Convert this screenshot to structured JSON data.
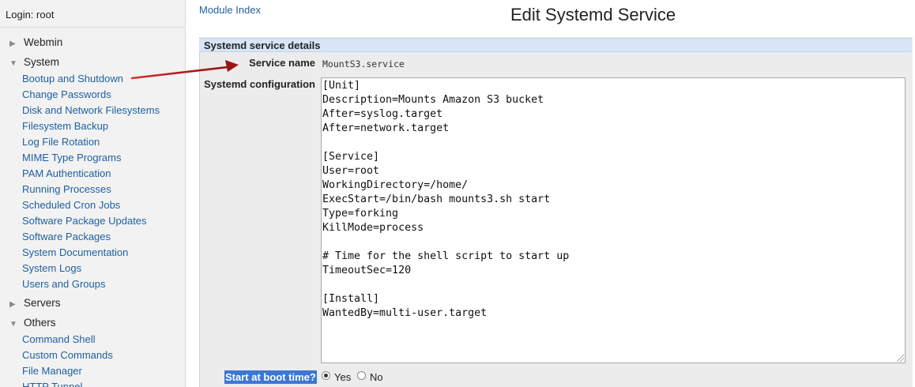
{
  "sidebar": {
    "login": "Login: root",
    "categories": [
      {
        "label": "Webmin",
        "state": "collapsed"
      },
      {
        "label": "System",
        "state": "expanded"
      },
      {
        "label": "Servers",
        "state": "collapsed"
      },
      {
        "label": "Others",
        "state": "expanded"
      }
    ],
    "system_modules": [
      "Bootup and Shutdown",
      "Change Passwords",
      "Disk and Network Filesystems",
      "Filesystem Backup",
      "Log File Rotation",
      "MIME Type Programs",
      "PAM Authentication",
      "Running Processes",
      "Scheduled Cron Jobs",
      "Software Package Updates",
      "Software Packages",
      "System Documentation",
      "System Logs",
      "Users and Groups"
    ],
    "others_modules": [
      "Command Shell",
      "Custom Commands",
      "File Manager",
      "HTTP Tunnel"
    ]
  },
  "header": {
    "module_index": "Module Index",
    "title": "Edit Systemd Service"
  },
  "form": {
    "section_title": "Systemd service details",
    "service_name_label": "Service name",
    "service_name_value": "MountS3.service",
    "config_label": "Systemd configuration",
    "config_text": "[Unit]\nDescription=Mounts Amazon S3 bucket\nAfter=syslog.target\nAfter=network.target\n\n[Service]\nUser=root\nWorkingDirectory=/home/\nExecStart=/bin/bash mounts3.sh start\nType=forking\nKillMode=process\n\n# Time for the shell script to start up\nTimeoutSec=120\n\n[Install]\nWantedBy=multi-user.target",
    "boot_label": "Start at boot time?",
    "boot_options": [
      {
        "label": "Yes",
        "selected": true
      },
      {
        "label": "No",
        "selected": false
      }
    ]
  },
  "colors": {
    "link": "#1f5f9f",
    "section_header_bg": "#d8e5f6",
    "highlight": "#3c77d4",
    "annotation_arrow": "#b01818"
  }
}
